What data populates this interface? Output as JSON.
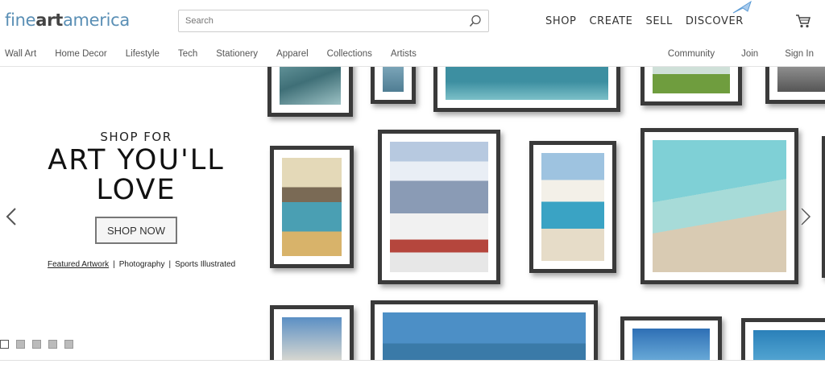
{
  "header": {
    "logo_pre": "fine",
    "logo_bold": "art",
    "logo_post": "america",
    "search_placeholder": "Search",
    "nav": [
      "SHOP",
      "CREATE",
      "SELL",
      "DISCOVER"
    ]
  },
  "subnav": {
    "left": [
      "Wall Art",
      "Home Decor",
      "Lifestyle",
      "Tech",
      "Stationery",
      "Apparel",
      "Collections",
      "Artists"
    ],
    "right": [
      "Community",
      "Join",
      "Sign In"
    ]
  },
  "hero": {
    "kicker": "SHOP FOR",
    "headline_line1": "ART YOU'LL",
    "headline_line2": "LOVE",
    "cta": "SHOP NOW",
    "links": [
      "Featured Artwork",
      "Photography",
      "Sports Illustrated"
    ],
    "slide_count": 5,
    "active_slide": 1
  },
  "colors": {
    "logo_blue": "#5a8fb5",
    "frame": "#3a3a3a",
    "accent_cursor": "#5b9bd5"
  }
}
